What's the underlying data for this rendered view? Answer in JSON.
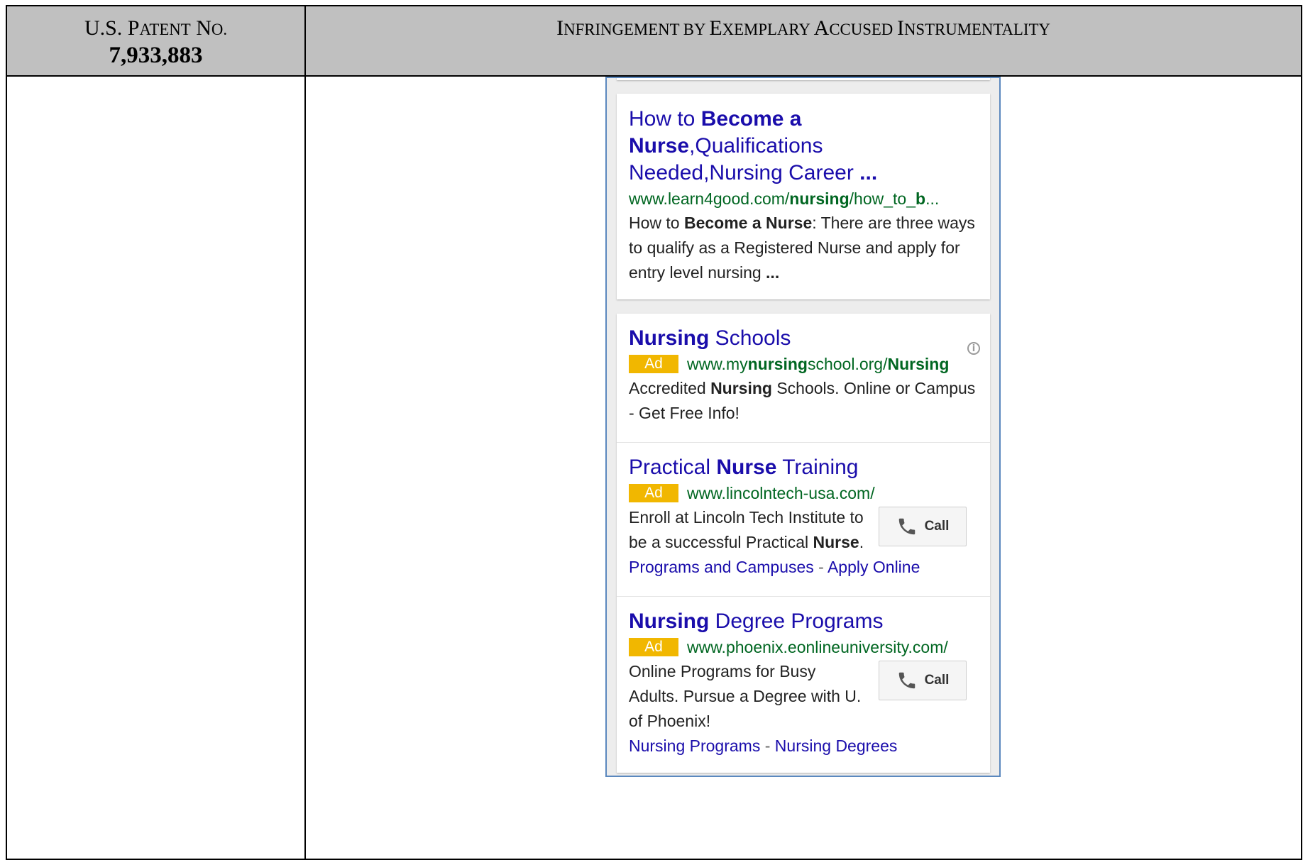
{
  "header": {
    "patent_label_first": "U.S. P",
    "patent_label_small": "ATENT",
    "patent_label_no_first": "N",
    "patent_label_no_small": "O.",
    "patent_number": "7,933,883",
    "right_title": [
      {
        "cap": "I",
        "small": "NFRINGEMENT BY "
      },
      {
        "cap": "E",
        "small": "XEMPLARY "
      },
      {
        "cap": "A",
        "small": "CCUSED "
      },
      {
        "cap": "I",
        "small": "NSTRUMENTALITY"
      }
    ]
  },
  "organic": {
    "title_1": "How to ",
    "title_2": "Become a",
    "title_3": "Nurse",
    "title_4": ",Qualifications",
    "title_5": "Needed,Nursing Career ",
    "title_6": "...",
    "url_1": "www.learn4good.com/",
    "url_2": "nursing",
    "url_3": "/how_to_",
    "url_4": "b",
    "url_5": "...",
    "snippet_1": "How to ",
    "snippet_2": "Become a Nurse",
    "snippet_3": ": There are three ways to qualify as a Registered Nurse and apply for entry level nursing ",
    "snippet_4": "..."
  },
  "ads": [
    {
      "title_bold": "Nursing",
      "title_rest": " Schools",
      "badge": "Ad",
      "url_1": "www.my",
      "url_2": "nursing",
      "url_3": "school.org/",
      "url_4": "Nursing",
      "desc_1": "Accredited ",
      "desc_2": "Nursing",
      "desc_3": " Schools. Online or Campus - Get Free Info!"
    },
    {
      "title_1": "Practical ",
      "title_bold": "Nurse",
      "title_rest": " Training",
      "badge": "Ad",
      "url": "www.lincolntech-usa.com/",
      "desc_1": "Enroll at Lincoln Tech Institute to",
      "desc_2": "be a successful Practical ",
      "desc_3": "Nurse",
      "desc_4": ".",
      "call_label": "Call",
      "link_1": "Programs and Campuses",
      "link_sep": " - ",
      "link_2": "Apply Online"
    },
    {
      "title_bold": "Nursing",
      "title_rest": " Degree Programs",
      "badge": "Ad",
      "url": "www.phoenix.eonlineuniversity.com/",
      "desc_1": "Online Programs for Busy",
      "desc_2": "Adults. Pursue a Degree with U.",
      "desc_3": "of Phoenix!",
      "call_label": "Call",
      "link_1": "Nursing Programs",
      "link_sep": " - ",
      "link_2": "Nursing Degrees"
    }
  ],
  "icons": {
    "info": "info-circle-icon",
    "phone": "phone-icon"
  },
  "colors": {
    "header_bg": "#c0c0c0",
    "link_blue": "#1a0dab",
    "url_green": "#006621",
    "ad_badge": "#f1b700",
    "frame_blue": "#5b88be"
  }
}
